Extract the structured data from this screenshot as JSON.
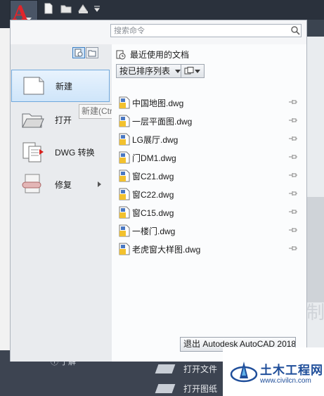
{
  "search": {
    "placeholder": "搜索命令"
  },
  "left_menu": {
    "items": [
      {
        "label": "新建",
        "icon": "new-document-icon",
        "selected": true
      },
      {
        "label": "打开",
        "icon": "open-folder-icon"
      },
      {
        "label": "DWG 转换",
        "icon": "dwg-convert-icon"
      },
      {
        "label": "修复",
        "icon": "repair-icon",
        "has_submenu": true
      }
    ],
    "tooltip": "新建(Ctrl+N)"
  },
  "recent": {
    "header": "最近使用的文档",
    "sort_label": "按已排序列表",
    "files": [
      {
        "name": "中国地图.dwg"
      },
      {
        "name": "一层平面图.dwg"
      },
      {
        "name": "LG展厅.dwg"
      },
      {
        "name": "门DM1.dwg"
      },
      {
        "name": "窗C21.dwg"
      },
      {
        "name": "窗C22.dwg"
      },
      {
        "name": "窗C15.dwg"
      },
      {
        "name": "一楼门.dwg"
      },
      {
        "name": "老虎窗大样图.dwg"
      }
    ]
  },
  "exit_label": "退出 Autodesk AutoCAD 2018",
  "background": {
    "rows": [
      "打开文件",
      "打开图纸"
    ],
    "hint": "ⓘ 了解"
  },
  "watermark": {
    "title": "土木工程网",
    "url": "www.civilcn.com"
  },
  "colors": {
    "accent": "#6fa8dc",
    "app_red": "#e0252b",
    "watermark_blue": "#1f4e9a"
  }
}
